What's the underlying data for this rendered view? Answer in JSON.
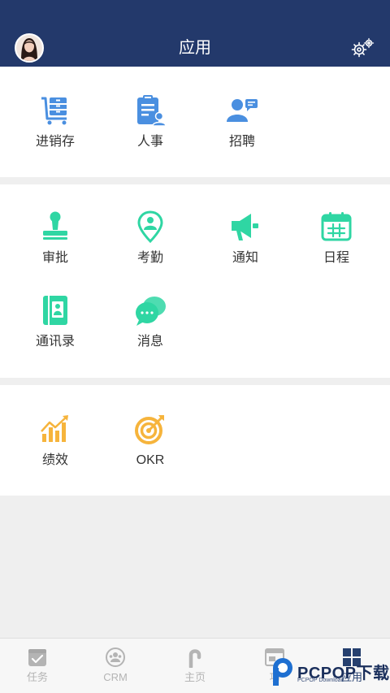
{
  "header": {
    "title": "应用"
  },
  "section1": {
    "apps": [
      {
        "label": "进销存",
        "icon": "inventory-cart-icon"
      },
      {
        "label": "人事",
        "icon": "hr-clipboard-icon"
      },
      {
        "label": "招聘",
        "icon": "recruit-person-icon"
      }
    ]
  },
  "section2": {
    "apps": [
      {
        "label": "审批",
        "icon": "stamp-icon"
      },
      {
        "label": "考勤",
        "icon": "location-pin-icon"
      },
      {
        "label": "通知",
        "icon": "megaphone-icon"
      },
      {
        "label": "日程",
        "icon": "calendar-icon"
      },
      {
        "label": "通讯录",
        "icon": "contact-book-icon"
      },
      {
        "label": "消息",
        "icon": "chat-bubbles-icon"
      }
    ]
  },
  "section3": {
    "apps": [
      {
        "label": "绩效",
        "icon": "performance-chart-icon"
      },
      {
        "label": "OKR",
        "icon": "target-icon"
      }
    ]
  },
  "tabbar": {
    "tabs": [
      {
        "label": "任务",
        "icon": "task-check-icon"
      },
      {
        "label": "CRM",
        "icon": "crm-icon"
      },
      {
        "label": "主页",
        "icon": "home-icon"
      },
      {
        "label": "功",
        "icon": "feature-icon"
      },
      {
        "label": "应用",
        "icon": "apps-grid-icon"
      }
    ]
  },
  "watermark": {
    "text": "PCPOP下载",
    "sub": "PCPOP Download"
  },
  "colors": {
    "header": "#23396b",
    "blue": "#4a8fe0",
    "green": "#2fd6a3",
    "orange": "#f6b43c",
    "active": "#26406f"
  }
}
